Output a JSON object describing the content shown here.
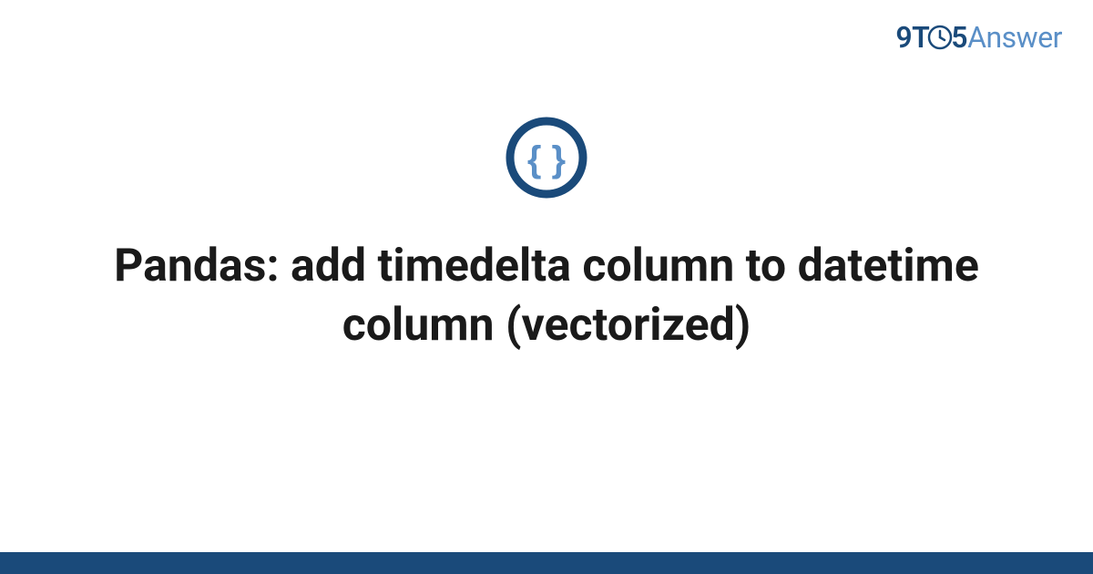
{
  "logo": {
    "part1": "9T",
    "part2": "5",
    "part3": "Answer"
  },
  "title": "Pandas: add timedelta column to datetime column (vectorized)",
  "icon_name": "code-braces-icon",
  "colors": {
    "dark_blue": "#1a4a7a",
    "light_blue": "#5a8fc7",
    "brace_blue": "#5a8fc7"
  }
}
